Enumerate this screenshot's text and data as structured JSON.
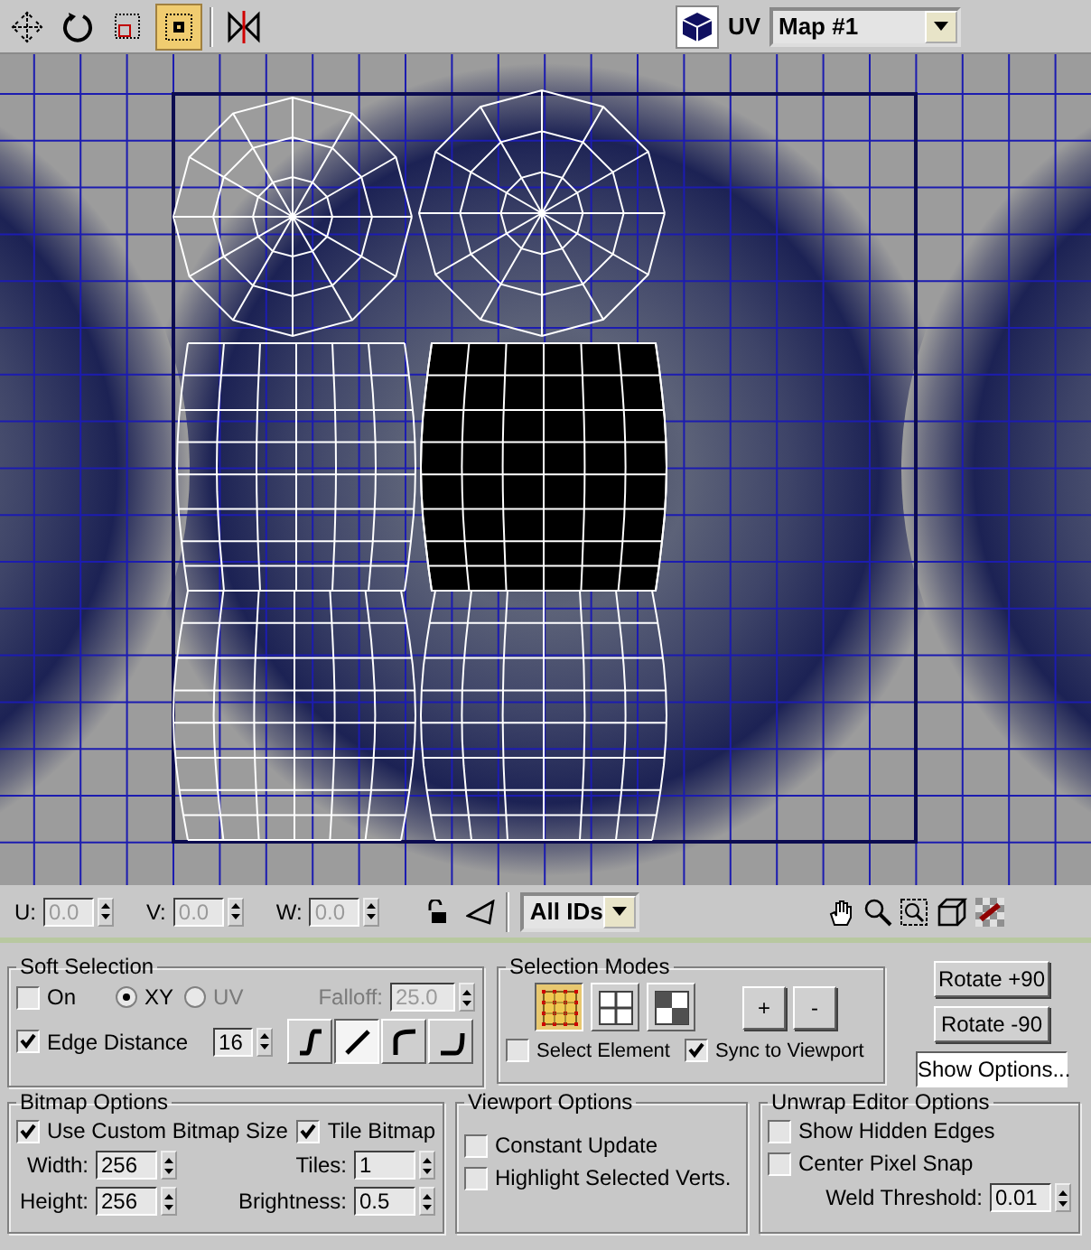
{
  "toolbar": {
    "tools": [
      {
        "kind": "move",
        "selected": false
      },
      {
        "kind": "rotate",
        "selected": false
      },
      {
        "kind": "scale",
        "selected": false
      },
      {
        "kind": "freeform",
        "selected": true
      },
      {
        "kind": "mirror",
        "selected": false
      }
    ],
    "uv_label": "UV",
    "map_select": {
      "value": "Map #1"
    }
  },
  "bottom_bar": {
    "coords": [
      {
        "label": "U:",
        "value": "0.0",
        "disabled": true
      },
      {
        "label": "V:",
        "value": "0.0",
        "disabled": true
      },
      {
        "label": "W:",
        "value": "0.0",
        "disabled": true
      }
    ],
    "id_filter": {
      "value": "All IDs"
    }
  },
  "soft_selection": {
    "title": "Soft Selection",
    "on": {
      "label": "On",
      "checked": false
    },
    "axes": [
      {
        "label": "XY",
        "selected": true
      },
      {
        "label": "UV",
        "selected": false
      }
    ],
    "falloff": {
      "label": "Falloff:",
      "value": "25.0",
      "disabled": true
    },
    "edge_distance": {
      "label": "Edge Distance",
      "checked": true,
      "value": "16"
    },
    "curves": [
      {
        "kind": "smooth",
        "selected": false
      },
      {
        "kind": "linear",
        "selected": true
      },
      {
        "kind": "convex",
        "selected": false
      },
      {
        "kind": "concave",
        "selected": false
      }
    ]
  },
  "selection_modes": {
    "title": "Selection Modes",
    "modes": [
      {
        "kind": "vertex",
        "selected": true
      },
      {
        "kind": "edge",
        "selected": false
      },
      {
        "kind": "face",
        "selected": false
      }
    ],
    "grow": "+",
    "shrink": "-",
    "select_element": {
      "label": "Select Element",
      "checked": false
    },
    "sync_to_viewport": {
      "label": "Sync to Viewport",
      "checked": true
    }
  },
  "buttons": [
    {
      "label": "Rotate +90",
      "pressed": false
    },
    {
      "label": "Rotate -90",
      "pressed": false
    },
    {
      "label": "Show Options...",
      "pressed": true
    }
  ],
  "bitmap_options": {
    "title": "Bitmap Options",
    "custom_size": {
      "label": "Use Custom Bitmap Size",
      "checked": true
    },
    "tile": {
      "label": "Tile Bitmap",
      "checked": true
    },
    "width": {
      "label": "Width:",
      "value": "256"
    },
    "height": {
      "label": "Height:",
      "value": "256"
    },
    "tiles": {
      "label": "Tiles:",
      "value": "1"
    },
    "brightness": {
      "label": "Brightness:",
      "value": "0.5"
    }
  },
  "viewport_options": {
    "title": "Viewport Options",
    "options": [
      {
        "label": "Constant Update",
        "checked": false
      },
      {
        "label": "Highlight Selected Verts.",
        "checked": false
      }
    ]
  },
  "unwrap_editor_options": {
    "title": "Unwrap Editor Options",
    "options": [
      {
        "label": "Show Hidden Edges",
        "checked": false
      },
      {
        "label": "Center Pixel Snap",
        "checked": false
      }
    ],
    "weld_threshold": {
      "label": "Weld Threshold:",
      "value": "0.01"
    }
  }
}
